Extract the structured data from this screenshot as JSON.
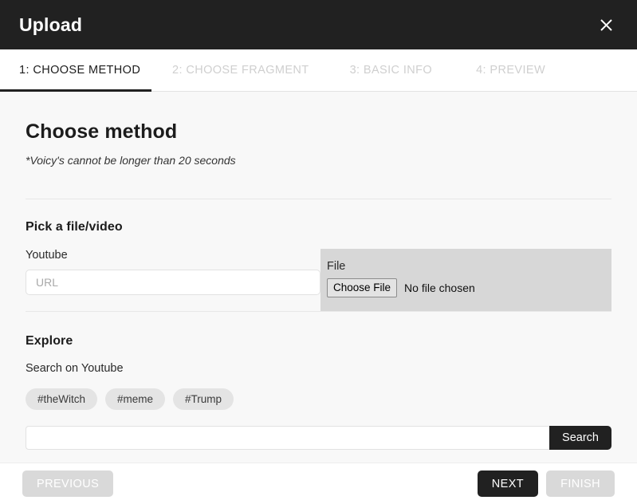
{
  "window": {
    "title": "Upload",
    "close_icon": "close-icon"
  },
  "tabs": [
    {
      "label": "1: CHOOSE METHOD",
      "active": true
    },
    {
      "label": "2: CHOOSE FRAGMENT",
      "active": false
    },
    {
      "label": "3: BASIC INFO",
      "active": false
    },
    {
      "label": "4: PREVIEW",
      "active": false
    }
  ],
  "main": {
    "heading": "Choose method",
    "note": "*Voicy's cannot be longer than 20 seconds",
    "pick_section": {
      "title": "Pick a file/video",
      "youtube_label": "Youtube",
      "url_placeholder": "URL",
      "url_value": "",
      "file_label": "File",
      "choose_file_label": "Choose File",
      "no_file_text": "No file chosen"
    },
    "explore_section": {
      "title": "Explore",
      "subtitle": "Search on Youtube",
      "tags": [
        "#theWitch",
        "#meme",
        "#Trump"
      ],
      "search_value": "",
      "search_placeholder": "",
      "search_button_label": "Search"
    }
  },
  "footer": {
    "previous_label": "PREVIOUS",
    "next_label": "NEXT",
    "finish_label": "FINISH"
  },
  "colors": {
    "dark": "#212121",
    "content_bg": "#f8f8f8",
    "file_panel_bg": "#d7d7d7",
    "tag_bg": "#e4e4e4",
    "disabled_btn": "#d9d9d9"
  }
}
